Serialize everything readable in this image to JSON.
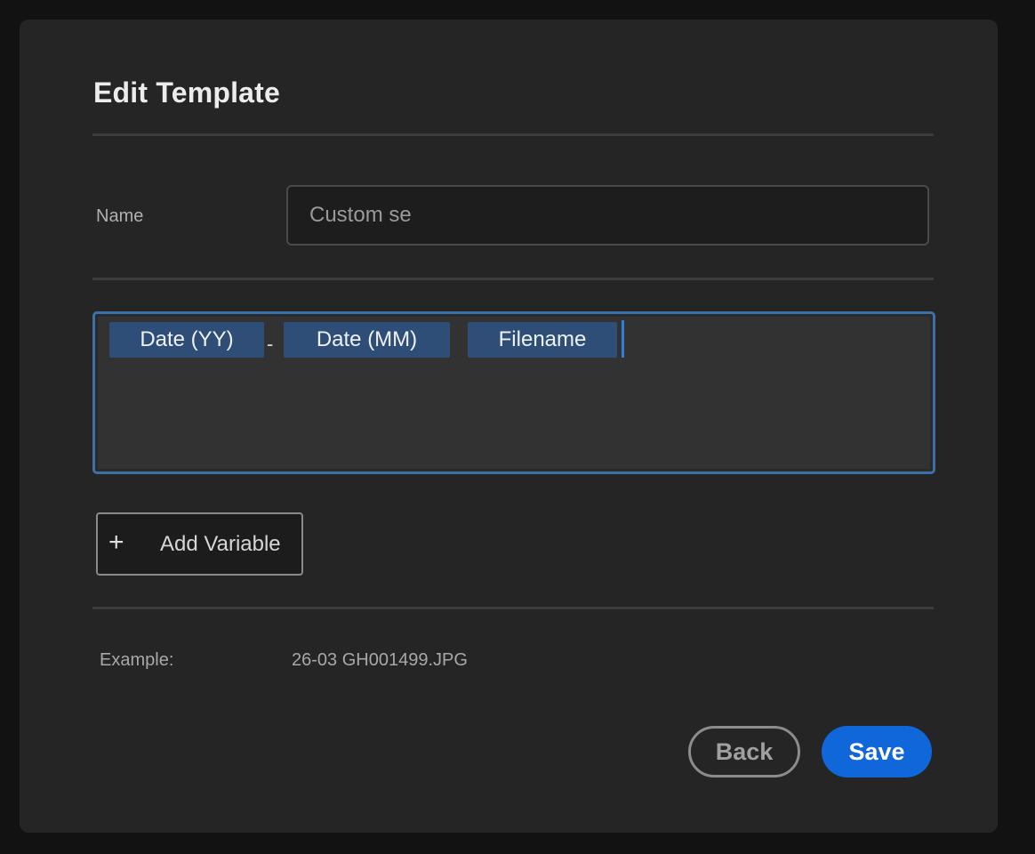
{
  "dialog": {
    "title": "Edit Template"
  },
  "name_field": {
    "label": "Name",
    "value": "Custom se"
  },
  "template_tokens": [
    {
      "label": "Date (YY)"
    },
    {
      "label": "Date (MM)"
    },
    {
      "label": "Filename"
    }
  ],
  "separator": "-",
  "add_variable": {
    "icon": "plus-icon",
    "label": "Add Variable"
  },
  "example": {
    "label": "Example:",
    "value": "26-03 GH001499.JPG"
  },
  "buttons": {
    "back_label": "Back",
    "save_label": "Save"
  },
  "colors": {
    "accent": "#0f67d9",
    "token_bg": "#2e4e77",
    "focus_border": "#3a71a8",
    "dialog_bg": "#252525"
  }
}
